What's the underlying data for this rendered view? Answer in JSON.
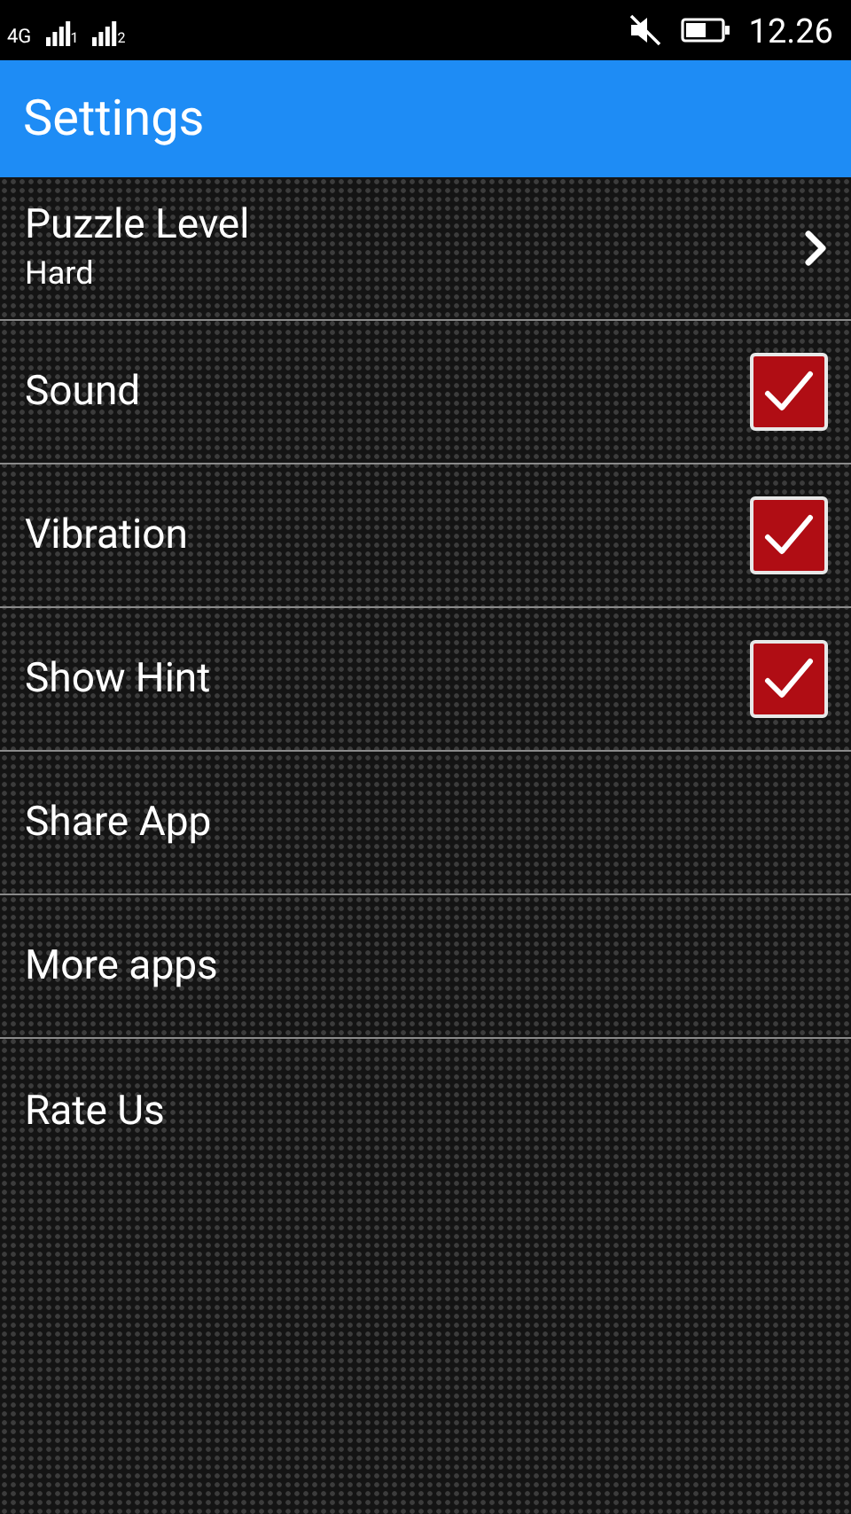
{
  "status_bar": {
    "network": "4G",
    "sims": [
      "1",
      "2"
    ],
    "time": "12.26"
  },
  "app_bar": {
    "title": "Settings"
  },
  "items": [
    {
      "kind": "chevron",
      "label": "Puzzle Level",
      "summary": "Hard"
    },
    {
      "kind": "checkbox",
      "label": "Sound",
      "checked": true
    },
    {
      "kind": "checkbox",
      "label": "Vibration",
      "checked": true
    },
    {
      "kind": "checkbox",
      "label": "Show Hint",
      "checked": true
    },
    {
      "kind": "plain",
      "label": "Share App"
    },
    {
      "kind": "plain",
      "label": "More apps"
    },
    {
      "kind": "plain",
      "label": "Rate Us"
    }
  ]
}
